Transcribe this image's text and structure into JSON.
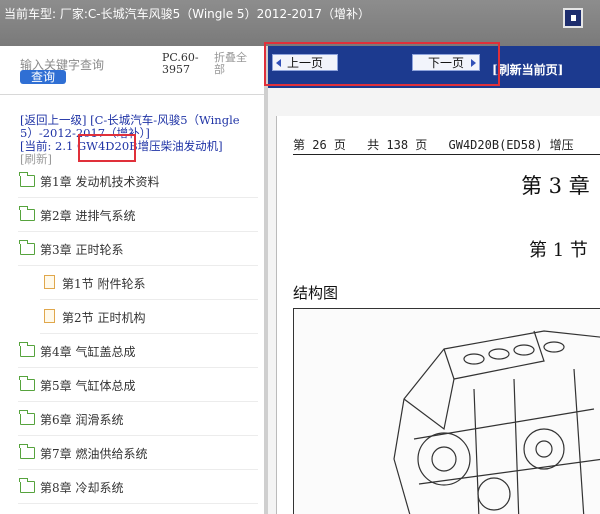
{
  "header": {
    "title": "当前车型:  厂家:C-长城汽车风骏5（Wingle 5）2012-2017（增补）",
    "menu_icon": "menu-icon"
  },
  "sidebar": {
    "search_placeholder": "输入关键字查询",
    "search_button": "查询",
    "pc_code": "PC.60-3957",
    "collapse_all": "折叠全部",
    "breadcrumb_back": "[返回上一级]",
    "breadcrumb_path": "[C-长城汽车-风骏5（Wingle 5）-2012-2017（增补）]",
    "current_label": "[当前:",
    "current_value": "2.1 GW4D20B增压柴油发动机]",
    "refresh": "[刷新]",
    "tree": [
      {
        "label": "第1章 发动机技术资料",
        "icon": "folder-icon"
      },
      {
        "label": "第2章 进排气系统",
        "icon": "folder-icon"
      },
      {
        "label": "第3章 正时轮系",
        "icon": "folder-open-icon"
      },
      {
        "label": "第1节 附件轮系",
        "icon": "document-icon"
      },
      {
        "label": "第2节 正时机构",
        "icon": "document-icon"
      },
      {
        "label": "第4章 气缸盖总成",
        "icon": "folder-icon"
      },
      {
        "label": "第5章 气缸体总成",
        "icon": "folder-icon"
      },
      {
        "label": "第6章 润滑系统",
        "icon": "folder-icon"
      },
      {
        "label": "第7章 燃油供给系统",
        "icon": "folder-icon"
      },
      {
        "label": "第8章 冷却系统",
        "icon": "folder-icon"
      }
    ]
  },
  "toolbar": {
    "prev": "上一页",
    "next": "下一页",
    "refresh_page": "[刷新当前页]"
  },
  "document": {
    "page": "第 26 页",
    "total": "共 138 页",
    "engine": "GW4D20B(ED58) 增压",
    "chapter": "第 3 章",
    "section": "第 1 节",
    "heading": "结构图"
  },
  "colors": {
    "header_bg": "#808080",
    "nav_bg": "#1c3a8f",
    "highlight": "#e0303a",
    "folder": "#56a33d",
    "link": "#2034a6"
  }
}
